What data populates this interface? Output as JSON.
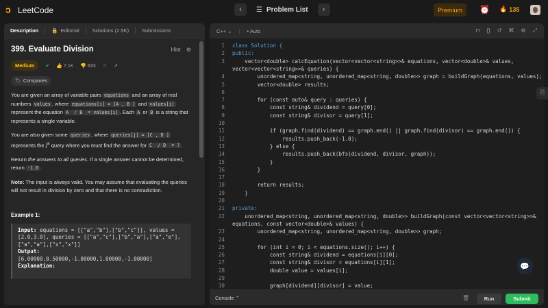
{
  "header": {
    "logo_text": "LeetCode",
    "problem_list": "Problem List",
    "premium": "Premium",
    "streak": "135"
  },
  "left_tabs": [
    {
      "label": "Description"
    },
    {
      "label": "Editorial"
    },
    {
      "label": "Solutions (2.5K)"
    },
    {
      "label": "Submissions"
    }
  ],
  "problem": {
    "title": "399. Evaluate Division",
    "hint": "Hint",
    "difficulty": "Medium",
    "likes": "7.1K",
    "dislikes": "633",
    "companies": "Companies"
  },
  "description": {
    "p1": [
      "You are given an array of variable pairs ",
      "equations",
      " and an array of real numbers ",
      "values",
      ", where ",
      "equations[i] = [A",
      ", B",
      "]",
      " and ",
      "values[i]",
      " represent the equation ",
      "A",
      " / B",
      " = values[i]",
      ". Each ",
      "A",
      " or ",
      "B",
      " is a string that represents a single variable."
    ],
    "p2": [
      "You are also given some ",
      "queries",
      ", where ",
      "queries[j] = [C",
      ", D",
      "]",
      " represents the ",
      "j",
      "th",
      " query where you must find the answer for ",
      "C",
      " / D",
      " = ?",
      "."
    ],
    "p3a": "Return ",
    "p3b": "the answers to all queries",
    "p3c": ". If a single answer cannot be determined, return ",
    "p3d": "-1.0",
    ".": "",
    "p3e": ".",
    "note_label": "Note:",
    "note_text": " The input is always valid. You may assume that evaluating the queries will not result in division by zero and that there is no contradiction."
  },
  "example": {
    "heading": "Example 1:",
    "input_label": "Input:",
    "input_text": " equations = [[\"a\",\"b\"],[\"b\",\"c\"]], values = [2.0,3.0], queries = [[\"a\",\"c\"],[\"b\",\"a\"],[\"a\",\"e\"],[\"a\",\"a\"],[\"x\",\"x\"]]",
    "output_label": "Output:",
    "output_text": "[6.00000,0.50000,-1.00000,1.00000,-1.00000]",
    "explanation_label": "Explanation:"
  },
  "editor": {
    "language": "C++",
    "mode": "Auto",
    "console": "Console",
    "run": "Run",
    "submit": "Submit"
  },
  "code": [
    {
      "n": "1",
      "t": "class Solution {"
    },
    {
      "n": "2",
      "t": "public:"
    },
    {
      "n": "3",
      "t": "    vector<double> calcEquation(vector<vector<string>>& equations, vector<double>& values,"
    },
    {
      "n": "",
      "t": "vector<vector<string>>& queries) {"
    },
    {
      "n": "4",
      "t": "        unordered_map<string, unordered_map<string, double>> graph = buildGraph(equations, values);"
    },
    {
      "n": "5",
      "t": "        vector<double> results;"
    },
    {
      "n": "6",
      "t": ""
    },
    {
      "n": "7",
      "t": "        for (const auto& query : queries) {"
    },
    {
      "n": "8",
      "t": "            const string& dividend = query[0];"
    },
    {
      "n": "9",
      "t": "            const string& divisor = query[1];"
    },
    {
      "n": "10",
      "t": ""
    },
    {
      "n": "11",
      "t": "            if (graph.find(dividend) == graph.end() || graph.find(divisor) == graph.end()) {"
    },
    {
      "n": "12",
      "t": "                results.push_back(-1.0);"
    },
    {
      "n": "13",
      "t": "            } else {"
    },
    {
      "n": "14",
      "t": "                results.push_back(bfs(dividend, divisor, graph));"
    },
    {
      "n": "15",
      "t": "            }"
    },
    {
      "n": "16",
      "t": "        }"
    },
    {
      "n": "17",
      "t": ""
    },
    {
      "n": "18",
      "t": "        return results;"
    },
    {
      "n": "19",
      "t": "    }"
    },
    {
      "n": "20",
      "t": ""
    },
    {
      "n": "21",
      "t": "private:"
    },
    {
      "n": "22",
      "t": "    unordered_map<string, unordered_map<string, double>> buildGraph(const vector<vector<string>>&"
    },
    {
      "n": "",
      "t": "equations, const vector<double>& values) {"
    },
    {
      "n": "23",
      "t": "        unordered_map<string, unordered_map<string, double>> graph;"
    },
    {
      "n": "24",
      "t": ""
    },
    {
      "n": "25",
      "t": "        for (int i = 0; i < equations.size(); i++) {"
    },
    {
      "n": "26",
      "t": "            const string& dividend = equations[i][0];"
    },
    {
      "n": "27",
      "t": "            const string& divisor = equations[i][1];"
    },
    {
      "n": "28",
      "t": "            double value = values[i];"
    },
    {
      "n": "29",
      "t": ""
    },
    {
      "n": "30",
      "t": "            graph[dividend][divisor] = value;"
    }
  ]
}
